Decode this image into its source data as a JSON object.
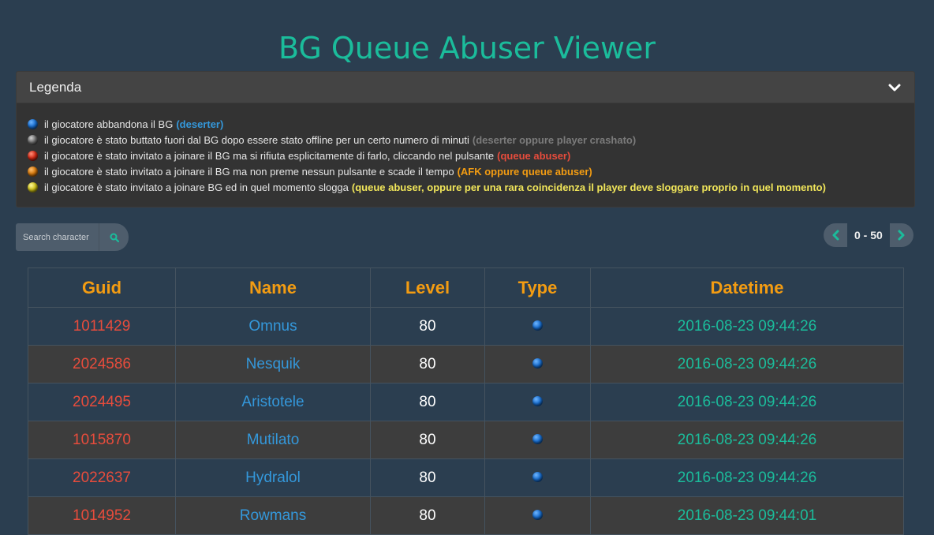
{
  "page": {
    "title": "BG Queue Abuser Viewer"
  },
  "legend": {
    "title": "Legenda",
    "toggle_icon": "chevron-down-icon",
    "items": [
      {
        "color": "blue",
        "text": "il giocatore abbandona il BG",
        "note": "(deserter)"
      },
      {
        "color": "gray",
        "text": "il giocatore è stato buttato fuori dal BG dopo essere stato offline per un certo numero di minuti",
        "note": "(deserter oppure player crashato)"
      },
      {
        "color": "red",
        "text": "il giocatore è stato invitato a joinare il BG ma si rifiuta esplicitamente di farlo, cliccando nel pulsante",
        "note": "(queue abuser)"
      },
      {
        "color": "orange",
        "text": "il giocatore è stato invitato a joinare il BG ma non preme nessun pulsante e scade il tempo",
        "note": "(AFK oppure queue abuser)"
      },
      {
        "color": "yellow",
        "text": "il giocatore è stato invitato a joinare BG ed in quel momento slogga",
        "note": "(queue abuser, oppure per una rara coincidenza il player deve sloggare proprio in quel momento)"
      }
    ]
  },
  "search": {
    "placeholder": "Search character",
    "value": "",
    "button_icon": "search-icon"
  },
  "pager": {
    "range": "0 - 50",
    "prev_icon": "chevron-left-icon",
    "next_icon": "chevron-right-icon"
  },
  "table": {
    "columns": [
      "Guid",
      "Name",
      "Level",
      "Type",
      "Datetime"
    ],
    "rows": [
      {
        "guid": "1011429",
        "name": "Omnus",
        "level": "80",
        "type": "blue",
        "datetime": "2016-08-23 09:44:26"
      },
      {
        "guid": "2024586",
        "name": "Nesquik",
        "level": "80",
        "type": "blue",
        "datetime": "2016-08-23 09:44:26"
      },
      {
        "guid": "2024495",
        "name": "Aristotele",
        "level": "80",
        "type": "blue",
        "datetime": "2016-08-23 09:44:26"
      },
      {
        "guid": "1015870",
        "name": "Mutilato",
        "level": "80",
        "type": "blue",
        "datetime": "2016-08-23 09:44:26"
      },
      {
        "guid": "2022637",
        "name": "Hydralol",
        "level": "80",
        "type": "blue",
        "datetime": "2016-08-23 09:44:26"
      },
      {
        "guid": "1014952",
        "name": "Rowmans",
        "level": "80",
        "type": "blue",
        "datetime": "2016-08-23 09:44:01"
      }
    ]
  },
  "colors": {
    "accent": "#1bbc9b",
    "header_text": "#f39c12",
    "guid": "#e74c3c",
    "name": "#3498db",
    "background": "#2b3e50"
  }
}
